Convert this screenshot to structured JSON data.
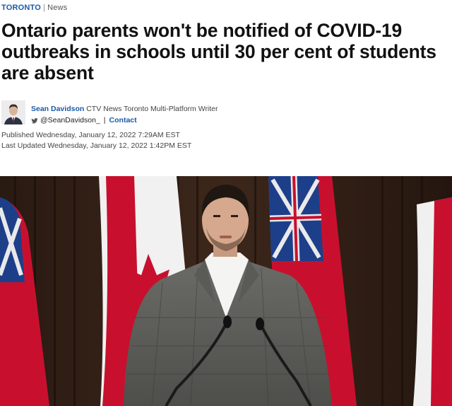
{
  "breadcrumb": {
    "region": "TORONTO",
    "separator": "|",
    "section": "News"
  },
  "headline": "Ontario parents won't be notified of COVID-19 outbreaks in schools until 30 per cent of students are absent",
  "byline": {
    "author": "Sean Davidson",
    "role": "CTV News Toronto Multi-Platform Writer",
    "handle": "@SeanDavidson_",
    "divider": "|",
    "contact_label": "Contact",
    "icon": "twitter-icon"
  },
  "dates": {
    "published": "Published Wednesday, January 12, 2022 7:29AM EST",
    "updated": "Last Updated Wednesday, January 12, 2022 1:42PM EST"
  },
  "colors": {
    "link": "#1a5aa6",
    "flag_red": "#c8102e"
  }
}
